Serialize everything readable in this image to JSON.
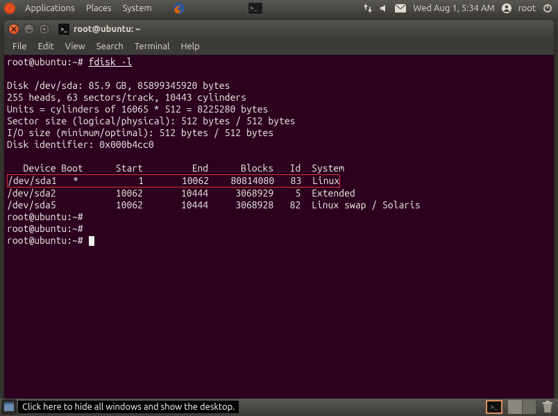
{
  "top_panel": {
    "menus": [
      "Applications",
      "Places",
      "System"
    ],
    "clock": "Wed Aug 1,  5:34 AM",
    "user": "root"
  },
  "window": {
    "title": "root@ubuntu: ~",
    "menubar": [
      "File",
      "Edit",
      "View",
      "Search",
      "Terminal",
      "Help"
    ]
  },
  "terminal": {
    "prompt": "root@ubuntu:~#",
    "command": "fdisk -l",
    "disk_info": [
      "Disk /dev/sda: 85.9 GB, 85899345920 bytes",
      "255 heads, 63 sectors/track, 10443 cylinders",
      "Units = cylinders of 16065 * 512 = 8225280 bytes",
      "Sector size (logical/physical): 512 bytes / 512 bytes",
      "I/O size (minimum/optimal): 512 bytes / 512 bytes",
      "Disk identifier: 0x000b4cc0"
    ],
    "table_header": "   Device Boot      Start         End      Blocks   Id  System",
    "rows": [
      {
        "text": "/dev/sda1   *           1       10062    80814080   83  Linux",
        "highlighted": true
      },
      {
        "text": "/dev/sda2           10062       10444     3068929    5  Extended",
        "highlighted": false
      },
      {
        "text": "/dev/sda5           10062       10444     3068928   82  Linux swap / Solaris",
        "highlighted": false
      }
    ],
    "trailing_prompts": 3
  },
  "bottom_panel": {
    "tooltip": "Click here to hide all windows and show the desktop."
  }
}
